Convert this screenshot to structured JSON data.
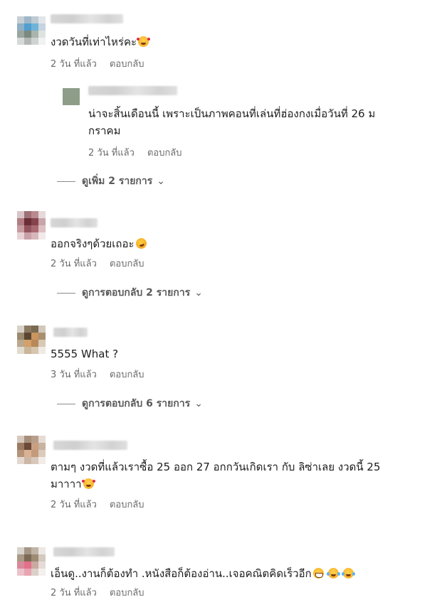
{
  "comments": [
    {
      "text": "งวดวันที่เท่าไหร่คะ",
      "emoji": "smiling-face-with-hearts",
      "time": "2 วัน ที่แล้ว",
      "reply_label": "ตอบกลับ",
      "replies": [
        {
          "text_line1": "น่าจะสิ้นเดือนนี้ เพราะเป็นภาพคอนที่เล่นที่ฮ่องกงเมื่อวันที่ 26 ม",
          "text_line2": "กราคม",
          "time": "2 วัน ที่แล้ว",
          "reply_label": "ตอบกลับ"
        }
      ],
      "more_label": "ดูเพิ่ม 2 รายการ"
    },
    {
      "text": "ออกจริงๆด้วยเถอะ",
      "emoji": "rolling-on-floor-laughing",
      "time": "2 วัน ที่แล้ว",
      "reply_label": "ตอบกลับ",
      "more_label": "ดูการตอบกลับ 2 รายการ"
    },
    {
      "text": "5555 What ?",
      "time": "3 วัน ที่แล้ว",
      "reply_label": "ตอบกลับ",
      "more_label": "ดูการตอบกลับ 6 รายการ"
    },
    {
      "text_line1": "ตามๆ งวดที่แล้วเราซื้อ 25 ออก 27 อกกวันเกิดเรา กับ ลิซ่าเลย งวดนี้ 25",
      "text_line2": "มาาาา",
      "emoji": "smiling-face-with-hearts",
      "time": "2 วัน ที่แล้ว",
      "reply_label": "ตอบกลับ"
    },
    {
      "text": "เอ็นดู..งานก็ต้องทำ .หนังสือก็ต้องอ่าน..เจอคณิตคิดเร็วอีก",
      "emojis": [
        "grinning-face",
        "face-with-tears-of-joy",
        "face-with-tears-of-joy"
      ],
      "time": "2 วัน ที่แล้ว",
      "reply_label": "ตอบกลับ"
    }
  ],
  "more_chevron": "chevron-down-icon",
  "colors": {
    "text": "#1c1c1c",
    "meta": "#6b6b6b",
    "more": "#5a5a5a"
  }
}
